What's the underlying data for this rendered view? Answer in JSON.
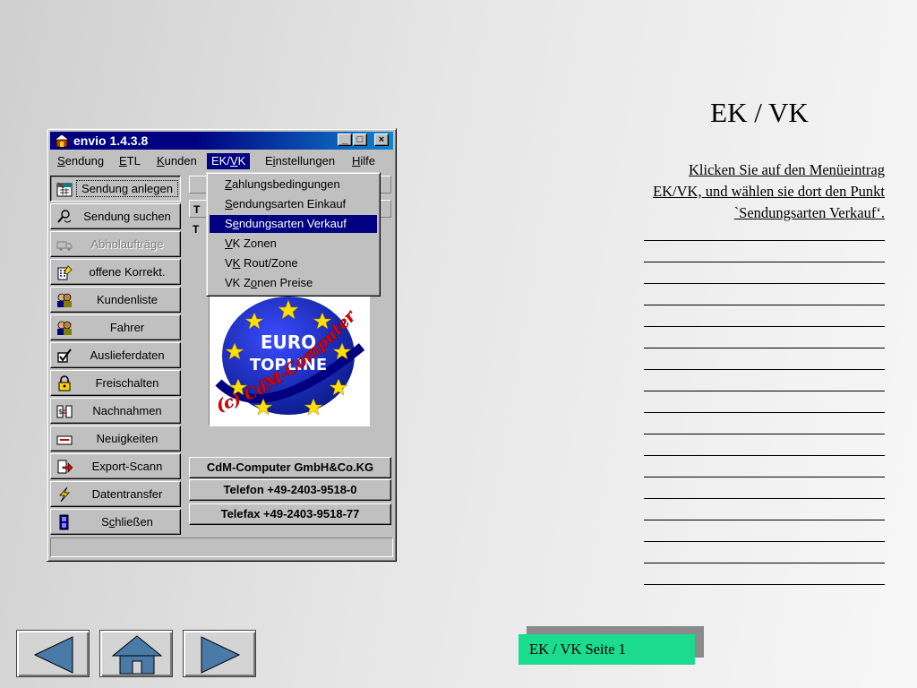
{
  "window": {
    "title": "envio 1.4.3.8",
    "minimize": "_",
    "maximize": "□",
    "close": "×"
  },
  "menu": {
    "sendung": {
      "accel": "S",
      "rest": "endung"
    },
    "etl": {
      "accel": "E",
      "rest": "TL"
    },
    "kunden": {
      "accel": "K",
      "rest": "unden"
    },
    "ekvk": {
      "pre": "EK/",
      "accel": "V",
      "rest": "K"
    },
    "einstellungen": {
      "pre": "E",
      "accel": "i",
      "rest": "nstellungen"
    },
    "hilfe": {
      "accel": "H",
      "rest": "ilfe"
    }
  },
  "dropdown": {
    "items": [
      {
        "pre": "",
        "accel": "Z",
        "rest": "ahlungsbedingungen"
      },
      {
        "pre": "",
        "accel": "S",
        "rest": "endungsarten Einkauf"
      },
      {
        "pre": "S",
        "accel": "e",
        "rest": "ndungsarten Verkauf"
      },
      {
        "pre": "",
        "accel": "V",
        "rest": "K Zonen"
      },
      {
        "pre": "V",
        "accel": "K",
        "rest": " Rout/Zone"
      },
      {
        "pre": "VK Z",
        "accel": "o",
        "rest": "nen Preise"
      }
    ]
  },
  "sidebar": {
    "items": [
      {
        "pre": "Sendung anlegen",
        "accel": "",
        "rest": ""
      },
      {
        "pre": "Sendung suchen",
        "accel": "",
        "rest": ""
      },
      {
        "pre": "Abholaufträge",
        "accel": "",
        "rest": ""
      },
      {
        "pre": "offene Korrekt.",
        "accel": "",
        "rest": ""
      },
      {
        "pre": "Kundenliste",
        "accel": "",
        "rest": ""
      },
      {
        "pre": "Fahrer",
        "accel": "",
        "rest": ""
      },
      {
        "pre": "Auslieferdaten",
        "accel": "",
        "rest": ""
      },
      {
        "pre": "Freischalten",
        "accel": "",
        "rest": ""
      },
      {
        "pre": "Nachnahmen",
        "accel": "",
        "rest": ""
      },
      {
        "pre": "Neuigkeiten",
        "accel": "",
        "rest": ""
      },
      {
        "pre": "Export-Scann",
        "accel": "",
        "rest": ""
      },
      {
        "pre": "Datentransfer",
        "accel": "",
        "rest": ""
      },
      {
        "pre": "S",
        "accel": "c",
        "rest": "hließen"
      }
    ]
  },
  "panel": {
    "strip_char_1": "T",
    "strip_char_2": "T",
    "logo": {
      "line1": "EURO",
      "line2": "TOPLINE",
      "arc": "(c) CdM-Computer"
    },
    "company": "CdM-Computer GmbH&Co.KG",
    "phone": "Telefon +49-2403-9518-0",
    "fax": "Telefax +49-2403-9518-77"
  },
  "slide": {
    "heading": "EK / VK",
    "description": "Klicken Sie auf den Menüeintrag EK/VK, und wählen sie dort den Punkt `Sendungsarten Verkauf‘.",
    "page_label": "EK / VK Seite 1"
  },
  "colors": {
    "titlebar": "#000080",
    "page_label_bg": "#1adb8e",
    "nav_icon": "#4a7aa8"
  }
}
